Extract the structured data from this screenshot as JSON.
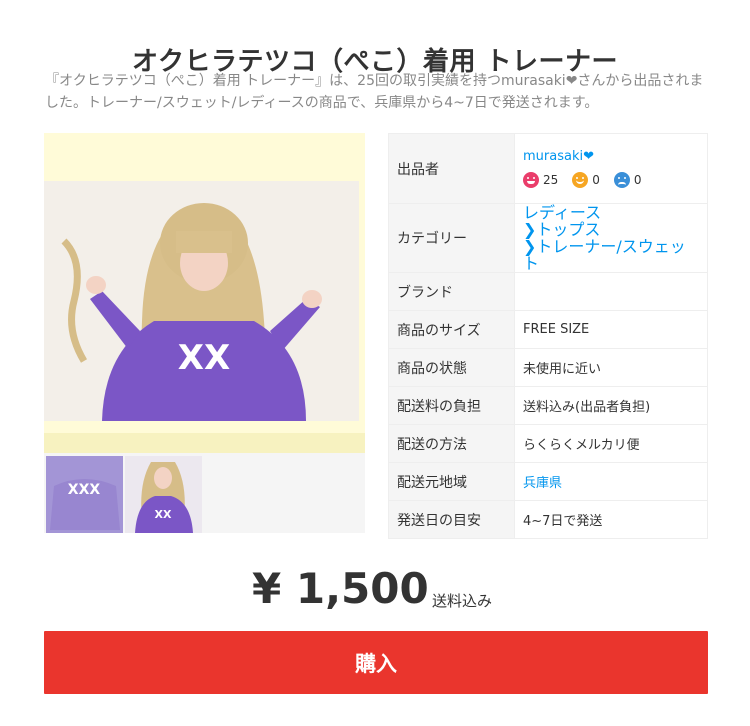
{
  "item": {
    "title": "オクヒラテツコ（ぺこ）着用 トレーナー",
    "description": "『オクヒラテツコ（ぺこ）着用 トレーナー』は、25回の取引実績を持つmurasaki❤さんから出品されました。トレーナー/スウェット/レディースの商品で、兵庫県から4~7日で発送されます。"
  },
  "photos": {
    "main_alt": "着用写真",
    "thumb_labels": [
      "sweatshirt-photo",
      "worn-photo"
    ]
  },
  "details": {
    "seller_label": "出品者",
    "seller_name": "murasaki",
    "seller_heart": "❤",
    "ratings": {
      "good": "25",
      "normal": "0",
      "bad": "0"
    },
    "category_label": "カテゴリー",
    "categories": [
      "レディース",
      "トップス",
      "トレーナー/スウェット"
    ],
    "brand_label": "ブランド",
    "brand_value": "",
    "size_label": "商品のサイズ",
    "size_value": "FREE SIZE",
    "condition_label": "商品の状態",
    "condition_value": "未使用に近い",
    "shipping_fee_label": "配送料の負担",
    "shipping_fee_value": "送料込み(出品者負担)",
    "shipping_method_label": "配送の方法",
    "shipping_method_value": "らくらくメルカリ便",
    "ship_from_label": "配送元地域",
    "ship_from_value": "兵庫県",
    "ship_days_label": "発送日の目安",
    "ship_days_value": "4~7日で発送"
  },
  "price": {
    "amount": "¥ 1,500",
    "note": "送料込み"
  },
  "buy_button_label": "購入",
  "colors": {
    "accent_red": "#ea352d",
    "link_blue": "#0095ee",
    "rating_good": "#ea3d6b",
    "rating_normal": "#f6a623",
    "rating_bad": "#3a8fd8"
  }
}
